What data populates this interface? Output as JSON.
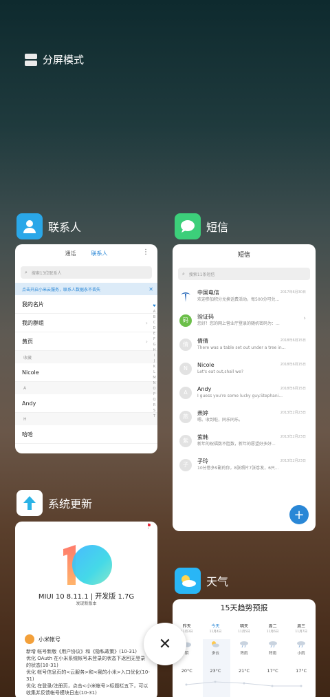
{
  "split_screen": {
    "label": "分屏模式"
  },
  "contacts": {
    "app_name": "联系人",
    "tabs": [
      "通话",
      "联系人"
    ],
    "search_placeholder": "搜索13位联系人",
    "banner": "点击开启小米云服务，联系人数据永不丢失",
    "rows": [
      {
        "type": "item",
        "label": "我的名片",
        "chevron": false
      },
      {
        "type": "item",
        "label": "我的群组",
        "chevron": true
      },
      {
        "type": "item",
        "label": "黄页",
        "chevron": true
      },
      {
        "type": "section",
        "label": "收藏"
      },
      {
        "type": "item",
        "label": "Nicole",
        "chevron": false
      },
      {
        "type": "section",
        "label": "A"
      },
      {
        "type": "item",
        "label": "Andy",
        "chevron": false
      },
      {
        "type": "section",
        "label": "H"
      },
      {
        "type": "item",
        "label": "哈哈",
        "chevron": false
      }
    ],
    "alphabet": [
      "♥",
      "A",
      "B",
      "C",
      "D",
      "E",
      "F",
      "G",
      "H",
      "I",
      "J",
      "K",
      "L",
      "M",
      "N",
      "O",
      "P",
      "Q",
      "R",
      "S",
      "T"
    ]
  },
  "messages": {
    "app_name": "短信",
    "title": "短信",
    "search_placeholder": "搜索11条短信",
    "threads": [
      {
        "name": "中国电信",
        "preview": "欢迎参加积分兑换话费活动，每500分可兑...",
        "date": "2017年6月30日",
        "avatar": "telecom",
        "avatar_color": "#1a5fb4"
      },
      {
        "name": "验证码",
        "preview": "您好！您的网上营业厅登录的随机密码为：...",
        "date": "",
        "avatar": "码",
        "avatar_color": "#6cbf4a"
      },
      {
        "name": "倩倩",
        "preview": "There was a table set out under a tree in...",
        "date": "2018年6月15日",
        "avatar": "倩",
        "avatar_color": "#e2e2e2"
      },
      {
        "name": "Nicole",
        "preview": "Let's eat out,shall we?",
        "date": "2018年6月15日",
        "avatar": "N",
        "avatar_color": "#e2e2e2"
      },
      {
        "name": "Andy",
        "preview": "I guess you're some lucky guy.Stephani...",
        "date": "2018年6月15日",
        "avatar": "A",
        "avatar_color": "#e2e2e2"
      },
      {
        "name": "燕婷",
        "preview": "嗯。收到啦，同乐同乐。",
        "date": "2013年2月23日",
        "avatar": "燕",
        "avatar_color": "#e2e2e2"
      },
      {
        "name": "紫韩",
        "preview": "新年的祝福数不胜数，新年的愿望好多好...",
        "date": "2013年2月23日",
        "avatar": "紫",
        "avatar_color": "#e2e2e2"
      },
      {
        "name": "子玲",
        "preview": "10分憋多9副的你，8张照片7张卷发，6只...",
        "date": "2013年2月23日",
        "avatar": "子",
        "avatar_color": "#e2e2e2"
      }
    ],
    "fab_symbol": "+"
  },
  "update": {
    "app_name": "系统更新",
    "version": "MIUI 10 8.11.1 | 开发版 1.7G",
    "subtitle": "发现新版本",
    "account_label": "小米帐号",
    "notes": [
      "新增 帐号新版《用户协议》和《隐私政策》(10-31)",
      "优化 OAuth 在小米系统帐号未登录的状态下返回无登录的状态(10-31)",
      "优化 帐号信息页的<云服务>和<我的小米>入口优化(10-31)",
      "优化 在登录/注册页，点击<小米帐号>标题栏五下，可以收集并反馈帐号模块日志(10-31)"
    ]
  },
  "weather": {
    "app_name": "天气",
    "title": "15天趋势预报",
    "days": [
      {
        "label": "昨天",
        "date": "11月3日",
        "cond": "阴",
        "temp": "20°C",
        "icon": "cloud"
      },
      {
        "label": "今天",
        "date": "11月4日",
        "cond": "多云",
        "temp": "23°C",
        "icon": "sun-cloud"
      },
      {
        "label": "明天",
        "date": "11月5日",
        "cond": "阵雨",
        "temp": "21°C",
        "icon": "rain"
      },
      {
        "label": "周二",
        "date": "11月6日",
        "cond": "阵雨",
        "temp": "17°C",
        "icon": "rain"
      },
      {
        "label": "周三",
        "date": "11月7日",
        "cond": "小雨",
        "temp": "17°C",
        "icon": "rain"
      }
    ]
  },
  "close_symbol": "✕"
}
